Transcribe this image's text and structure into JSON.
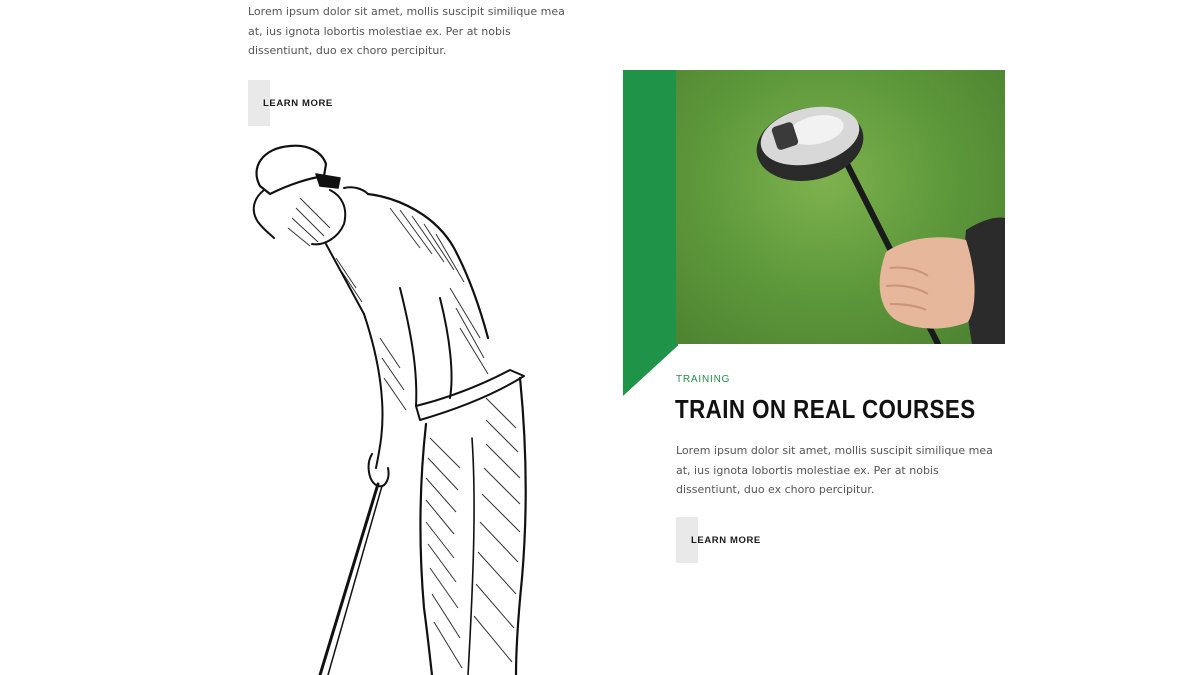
{
  "left_card": {
    "description": "Lorem ipsum dolor sit amet, mollis suscipit similique mea at, ius ignota lobortis molestiae ex. Per at nobis dissentiunt, duo ex choro percipitur.",
    "button_label": "LEARN MORE"
  },
  "right_card": {
    "category": "TRAINING",
    "title": "TRAIN ON REAL COURSES",
    "description": "Lorem ipsum dolor sit amet, mollis suscipit similique mea at, ius ignota lobortis molestiae ex. Per at nobis dissentiunt, duo ex choro percipitur.",
    "button_label": "LEARN MORE"
  },
  "colors": {
    "accent_green": "#1f9448",
    "button_bg": "#e9e9e9",
    "text_body": "#555555",
    "heading": "#111111"
  }
}
